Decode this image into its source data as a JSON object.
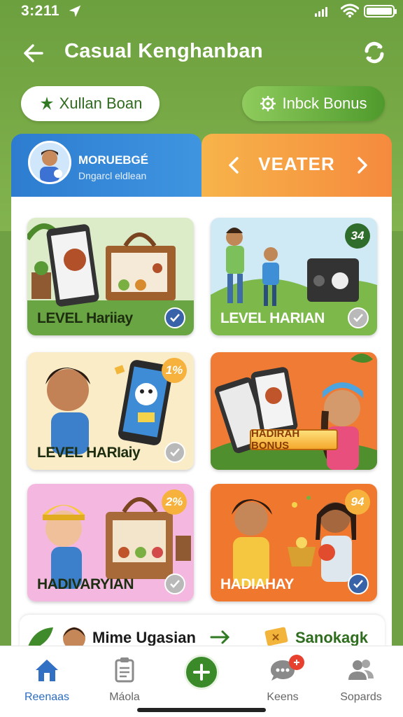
{
  "status_bar": {
    "time": "3:211"
  },
  "header": {
    "title": "Casual Kenghanban"
  },
  "pills": {
    "left_label": "Xullan Boan",
    "right_label": "Inbck Bonus"
  },
  "profile": {
    "name": "MORUEBGÉ",
    "subtitle": "Dngarcl eldlean"
  },
  "level_tab": {
    "label": "VEATER"
  },
  "cards": [
    {
      "label": "LEVEL Hariiay",
      "badge": "",
      "check": "blue"
    },
    {
      "label": "LEVEL HARIAN",
      "badge": "34",
      "check": "grey"
    },
    {
      "label": "LEVEL HARIaiy",
      "badge": "1%",
      "check": "grey"
    },
    {
      "label": "",
      "badge": "",
      "check": "",
      "banner": "HADIRAH BONUS"
    },
    {
      "label": "HADIVARYIAN",
      "badge": "2%",
      "check": "grey"
    },
    {
      "label": "HADIAHAY",
      "badge": "94",
      "check": "blue"
    }
  ],
  "strip": {
    "left_text": "Mime Ugasian",
    "right_text": "Sanokagk"
  },
  "bottom_nav": [
    {
      "label": "Reenaas",
      "active": true
    },
    {
      "label": "Máola",
      "active": false
    },
    {
      "label": "",
      "active": false
    },
    {
      "label": "Keens",
      "active": false,
      "badge": ""
    },
    {
      "label": "Sopards",
      "active": false
    }
  ],
  "colors": {
    "header_green": "#6c9f3e",
    "profile_blue": "#2d7cd0",
    "level_orange": "#f58a3e",
    "nav_active": "#2b6cc1",
    "check_blue": "#3863a8"
  }
}
